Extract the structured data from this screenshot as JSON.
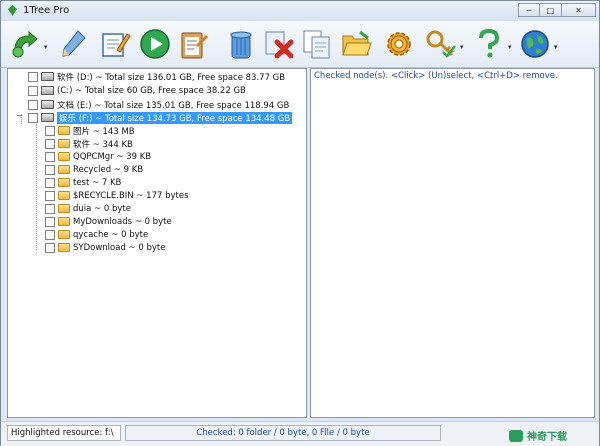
{
  "window": {
    "title": "1Tree Pro"
  },
  "toolbar": {
    "buttons": [
      {
        "name": "refresh",
        "icon": "green-arrow-refresh-icon"
      },
      {
        "name": "edit",
        "icon": "pencil-icon"
      },
      {
        "name": "notes",
        "icon": "notepad-icon"
      },
      {
        "name": "start",
        "icon": "green-play-icon"
      },
      {
        "name": "checklist",
        "icon": "clipboard-icon"
      },
      {
        "name": "recycle",
        "icon": "recycle-bin-icon"
      },
      {
        "name": "delete",
        "icon": "red-x-icon"
      },
      {
        "name": "copy",
        "icon": "copy-documents-icon"
      },
      {
        "name": "folder-open",
        "icon": "folder-open-icon"
      },
      {
        "name": "settings",
        "icon": "gear-icon"
      },
      {
        "name": "register",
        "icon": "key-icon"
      },
      {
        "name": "help",
        "icon": "help-question-icon"
      },
      {
        "name": "web",
        "icon": "globe-icon"
      }
    ]
  },
  "tree": {
    "drives": [
      {
        "label": "软件 (D:) ~ Total size 136.01 GB, Free space 83.77 GB"
      },
      {
        "label": "(C:) ~ Total size 60 GB, Free space 38.22 GB"
      },
      {
        "label": "文档 (E:) ~ Total size 135.01 GB, Free space 118.94 GB"
      },
      {
        "label": "娱乐 (F:) ~ Total size 134.73 GB, Free space 134.48 GB"
      }
    ],
    "folders": [
      {
        "label": "图片 ~ 143 MB"
      },
      {
        "label": "软件 ~ 344 KB"
      },
      {
        "label": "QQPCMgr ~ 39 KB"
      },
      {
        "label": "Recycled ~ 9 KB"
      },
      {
        "label": "test ~ 7 KB"
      },
      {
        "label": "$RECYCLE.BIN ~ 177 bytes"
      },
      {
        "label": "duia ~ 0 byte"
      },
      {
        "label": "MyDownloads ~ 0 byte"
      },
      {
        "label": "qycache ~ 0 byte"
      },
      {
        "label": "SYDownload ~ 0 byte"
      }
    ]
  },
  "right_pane": {
    "hint": "Checked node(s). <Click> (Un)select, <Ctrl+D> remove."
  },
  "status": {
    "highlighted": "Highlighted resource: f:\\",
    "checked": "Checked:  0 folder / 0  byte, 0 File / 0  byte"
  },
  "watermark": {
    "text": "神奇下载"
  }
}
